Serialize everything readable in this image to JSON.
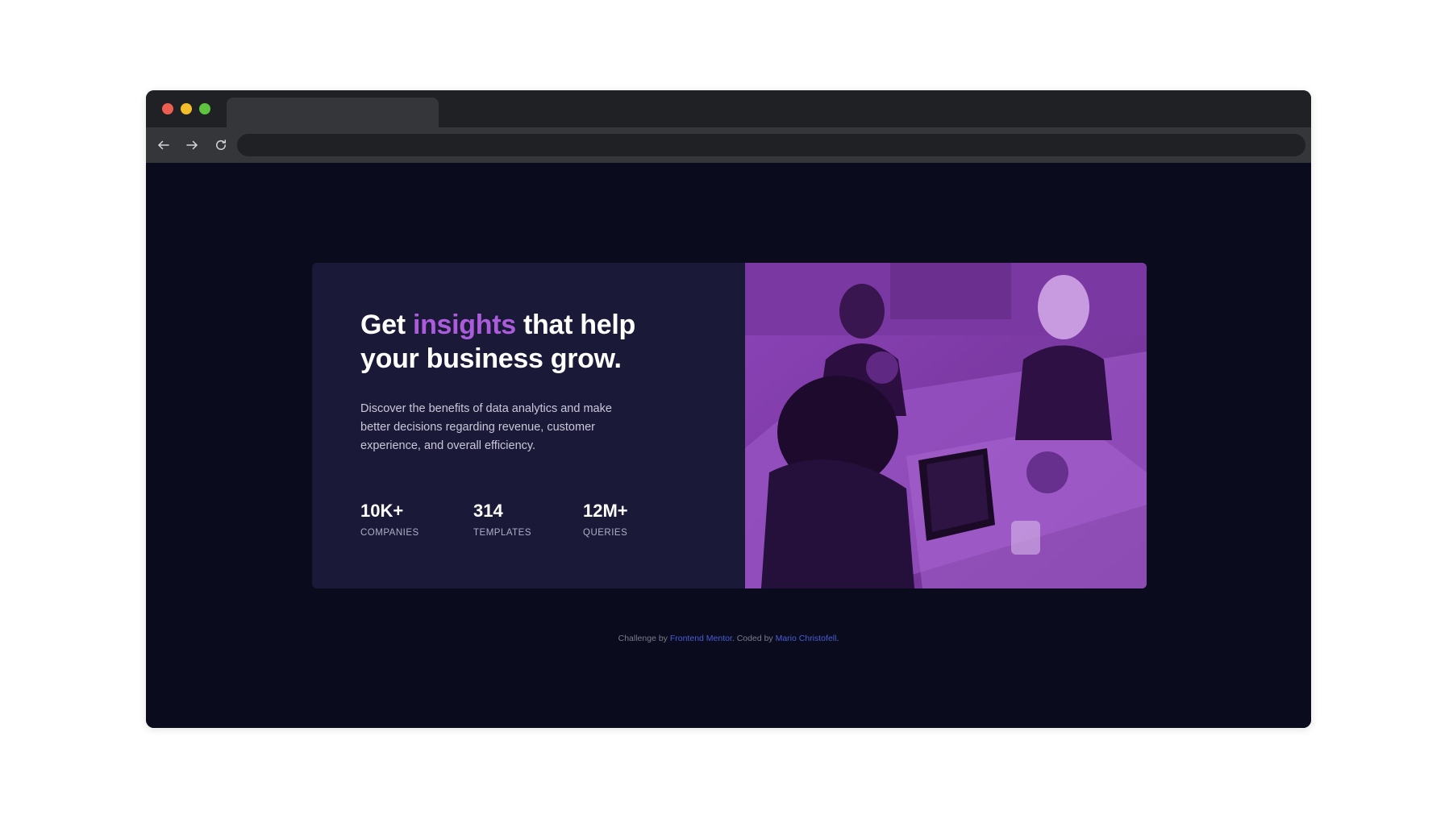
{
  "browser": {
    "tab_title": "",
    "url": ""
  },
  "card": {
    "headline_prefix": "Get ",
    "headline_accent": "insights",
    "headline_suffix": " that help your business grow.",
    "description": "Discover the benefits of data analytics and make better decisions regarding revenue, customer experience, and overall efficiency.",
    "stats": [
      {
        "value": "10K+",
        "label": "COMPANIES"
      },
      {
        "value": "314",
        "label": "TEMPLATES"
      },
      {
        "value": "12M+",
        "label": "QUERIES"
      }
    ],
    "image_icon": "office-team-photo"
  },
  "attribution": {
    "prefix": "Challenge by ",
    "link1": "Frontend Mentor",
    "middle": ". Coded by ",
    "link2": "Mario Christofell",
    "suffix": "."
  },
  "colors": {
    "page_bg": "#0a0c1e",
    "card_bg": "#1b1938",
    "accent": "#ab5cdb",
    "image_tint": "#7d3aa6",
    "link": "#4a5cd6"
  }
}
